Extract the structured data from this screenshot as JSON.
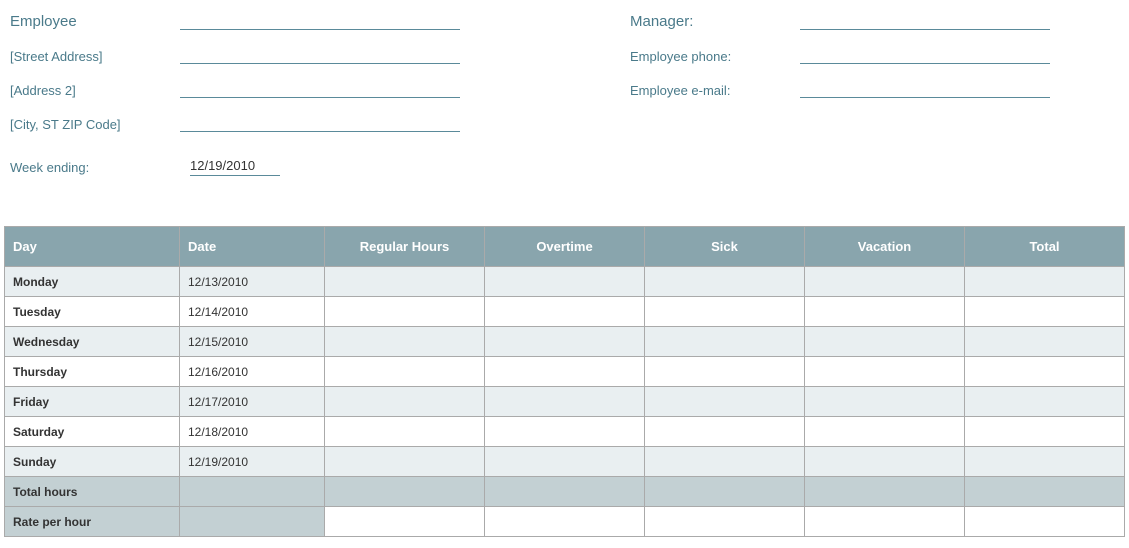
{
  "header": {
    "left": [
      {
        "label": "Employee",
        "big": true
      },
      {
        "label": "[Street Address]",
        "big": false
      },
      {
        "label": "[Address 2]",
        "big": false
      },
      {
        "label": "[City, ST  ZIP Code]",
        "big": false
      }
    ],
    "right": [
      {
        "label": "Manager:",
        "big": true
      },
      {
        "label": "Employee phone:",
        "big": false
      },
      {
        "label": "Employee e-mail:",
        "big": false
      }
    ]
  },
  "week_ending": {
    "label": "Week ending:",
    "value": "12/19/2010"
  },
  "table": {
    "headers": [
      "Day",
      "Date",
      "Regular Hours",
      "Overtime",
      "Sick",
      "Vacation",
      "Total"
    ],
    "rows": [
      {
        "day": "Monday",
        "date": "12/13/2010",
        "regular": "",
        "overtime": "",
        "sick": "",
        "vacation": "",
        "total": ""
      },
      {
        "day": "Tuesday",
        "date": "12/14/2010",
        "regular": "",
        "overtime": "",
        "sick": "",
        "vacation": "",
        "total": ""
      },
      {
        "day": "Wednesday",
        "date": "12/15/2010",
        "regular": "",
        "overtime": "",
        "sick": "",
        "vacation": "",
        "total": ""
      },
      {
        "day": "Thursday",
        "date": "12/16/2010",
        "regular": "",
        "overtime": "",
        "sick": "",
        "vacation": "",
        "total": ""
      },
      {
        "day": "Friday",
        "date": "12/17/2010",
        "regular": "",
        "overtime": "",
        "sick": "",
        "vacation": "",
        "total": ""
      },
      {
        "day": "Saturday",
        "date": "12/18/2010",
        "regular": "",
        "overtime": "",
        "sick": "",
        "vacation": "",
        "total": ""
      },
      {
        "day": "Sunday",
        "date": "12/19/2010",
        "regular": "",
        "overtime": "",
        "sick": "",
        "vacation": "",
        "total": ""
      }
    ],
    "summary": [
      {
        "label": "Total hours",
        "white_cells": false
      },
      {
        "label": "Rate per hour",
        "white_cells": true
      }
    ]
  }
}
